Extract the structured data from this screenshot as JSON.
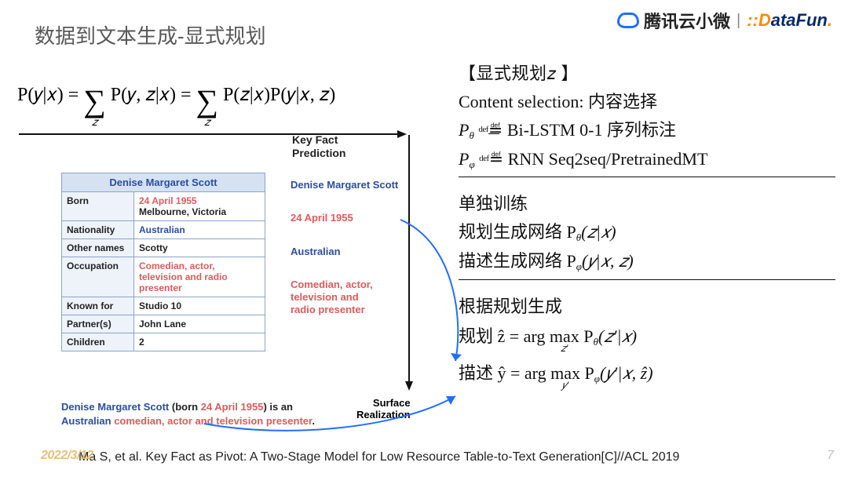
{
  "title": "数据到文本生成-显式规划",
  "logos": {
    "tencent": "腾讯云小微",
    "datafun_d": "D",
    "datafun_ata": "ata",
    "datafun_fun": "Fun",
    "datafun_dot": "."
  },
  "formula": {
    "lhs": "P(𝑦|𝑥) = ",
    "mid": " P(𝑦, 𝑧|𝑥) = ",
    "rhs": " P(𝑧|𝑥)P(𝑦|𝑥, 𝑧)",
    "sigma_sub": "𝑧"
  },
  "labels": {
    "key_fact_prediction_1": "Key Fact",
    "key_fact_prediction_2": "Prediction",
    "surface_realization_1": "Surface",
    "surface_realization_2": "Realization"
  },
  "table": {
    "header": "Denise Margaret Scott",
    "rows": [
      {
        "k": "Born",
        "v_sel": "24 April 1955",
        "v2": "Melbourne, Victoria"
      },
      {
        "k": "Nationality",
        "v": "Australian"
      },
      {
        "k": "Other names",
        "v_plain": "Scotty"
      },
      {
        "k": "Occupation",
        "v_sel_multi": "Comedian, actor, television and radio presenter"
      },
      {
        "k": "Known for",
        "v_plain": "Studio 10"
      },
      {
        "k": "Partner(s)",
        "v_plain": "John Lane"
      },
      {
        "k": "Children",
        "v_plain": "2"
      }
    ]
  },
  "facts": {
    "f1": "Denise Margaret Scott",
    "f2": "24 April 1955",
    "f3": "Australian",
    "f4": "Comedian, actor, television and radio presenter"
  },
  "sentence": {
    "p1": "Denise Margaret Scott",
    "p2": " (born ",
    "p3": "24 April 1955",
    "p4": ") is an ",
    "p5": "Australian",
    "p6": " ",
    "p7": "comedian, actor and television presenter",
    "p8": "."
  },
  "right": {
    "box_title": "【显式规划𝑧 】",
    "content_sel": "Content selection: 内容选择",
    "ptheta": "P",
    "ptheta_sub": "θ",
    "defeq": "def",
    "ptheta_rhs": " Bi-LSTM 0-1 序列标注",
    "pphi": "P",
    "pphi_sub": "φ",
    "pphi_rhs": " RNN Seq2seq/PretrainedMT",
    "sect1": "单独训练",
    "sect1_l1a": "规划生成网络 P",
    "sect1_l1b": "(𝑧|𝑥)",
    "sect1_l2a": "描述生成网络 P",
    "sect1_l2b": "(𝑦|𝑥, 𝑧)",
    "sect2": "根据规划生成",
    "sect2_l1a": "规划 ẑ = arg ",
    "sect2_l1_max": "max",
    "sect2_l1_under": "𝑧′",
    "sect2_l1b": " P",
    "sect2_l1c": "(𝑧′|𝑥)",
    "sect2_l2a": "描述 ŷ = arg ",
    "sect2_l2_under": "𝑦′",
    "sect2_l2b": " P",
    "sect2_l2c": "(𝑦′|𝑥, ẑ)"
  },
  "citation": "Ma S, et al. Key Fact as Pivot: A Two-Stage Model for Low Resource Table-to-Text Generation[C]//ACL 2019",
  "date": "2022/3/12",
  "page": "7"
}
